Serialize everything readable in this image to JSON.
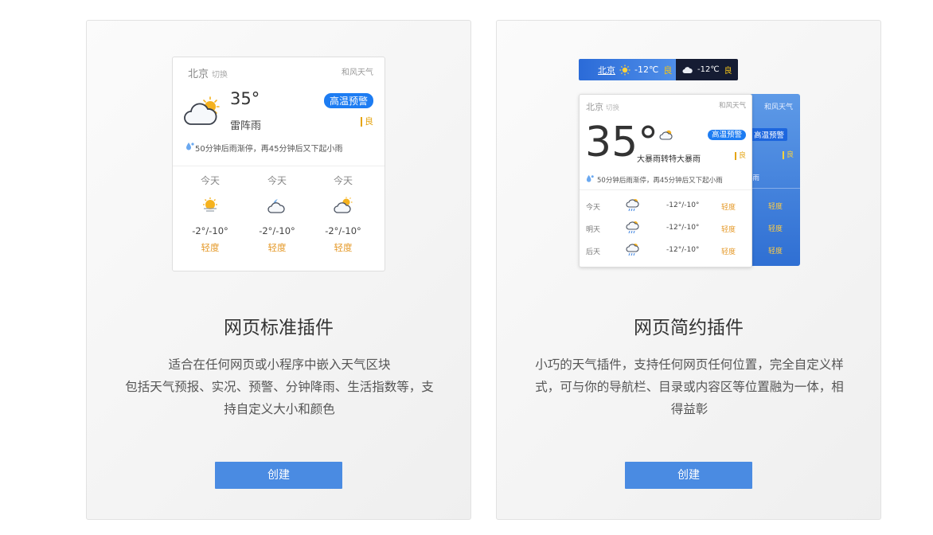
{
  "cards": [
    {
      "title": "网页标准插件",
      "desc": [
        "适合在任何网页或小程序中嵌入天气区块",
        "包括天气预报、实况、预警、分钟降雨、生活指数等，支",
        "持自定义大小和颜色"
      ],
      "button": "创建",
      "widget": {
        "city": "北京",
        "switch": "切换",
        "brand": "和风天气",
        "temp": "35°",
        "condition": "雷阵雨",
        "alert": "高温预警",
        "aqi": "良",
        "minute": "50分钟后雨渐停，再45分钟后又下起小雨",
        "forecast": [
          {
            "day": "今天",
            "icon": "sunny-haze-icon",
            "range": "-2°/-10°",
            "quality": "轻度"
          },
          {
            "day": "今天",
            "icon": "cloudy-moon-icon",
            "range": "-2°/-10°",
            "quality": "轻度"
          },
          {
            "day": "今天",
            "icon": "partly-cloudy-icon",
            "range": "-2°/-10°",
            "quality": "轻度"
          }
        ]
      }
    },
    {
      "title": "网页简约插件",
      "desc": [
        "小巧的天气插件，支持任何网页任何位置，完全自定义样",
        "式，可与你的导航栏、目录或内容区等位置融为一体，相",
        "得益彰"
      ],
      "button": "创建",
      "bar": {
        "city": "北京",
        "temp": "-12℃",
        "aqi": "良",
        "dark_temp": "-12℃"
      },
      "widget": {
        "city": "北京",
        "switch": "切换",
        "brand": "和风天气",
        "temp": "35°",
        "condition": "大暴雨转特大暴雨",
        "alert": "高温预警",
        "aqi": "良",
        "minute": "50分钟后雨渐停，再45分钟后又下起小雨",
        "forecast": [
          {
            "day": "今天",
            "range": "-12°/-10°",
            "quality": "轻度"
          },
          {
            "day": "明天",
            "range": "-12°/-10°",
            "quality": "轻度"
          },
          {
            "day": "后天",
            "range": "-12°/-10°",
            "quality": "轻度"
          }
        ]
      },
      "back": {
        "brand": "和风天气",
        "alert": "高温预警",
        "aqi": "良",
        "tail": "小雨",
        "quality": [
          "轻度",
          "轻度",
          "轻度"
        ]
      }
    }
  ],
  "colors": {
    "accent": "#4a8be2",
    "alert": "#1d7cf2",
    "quality": "#e59a2a",
    "aqi": "#e5a514"
  }
}
